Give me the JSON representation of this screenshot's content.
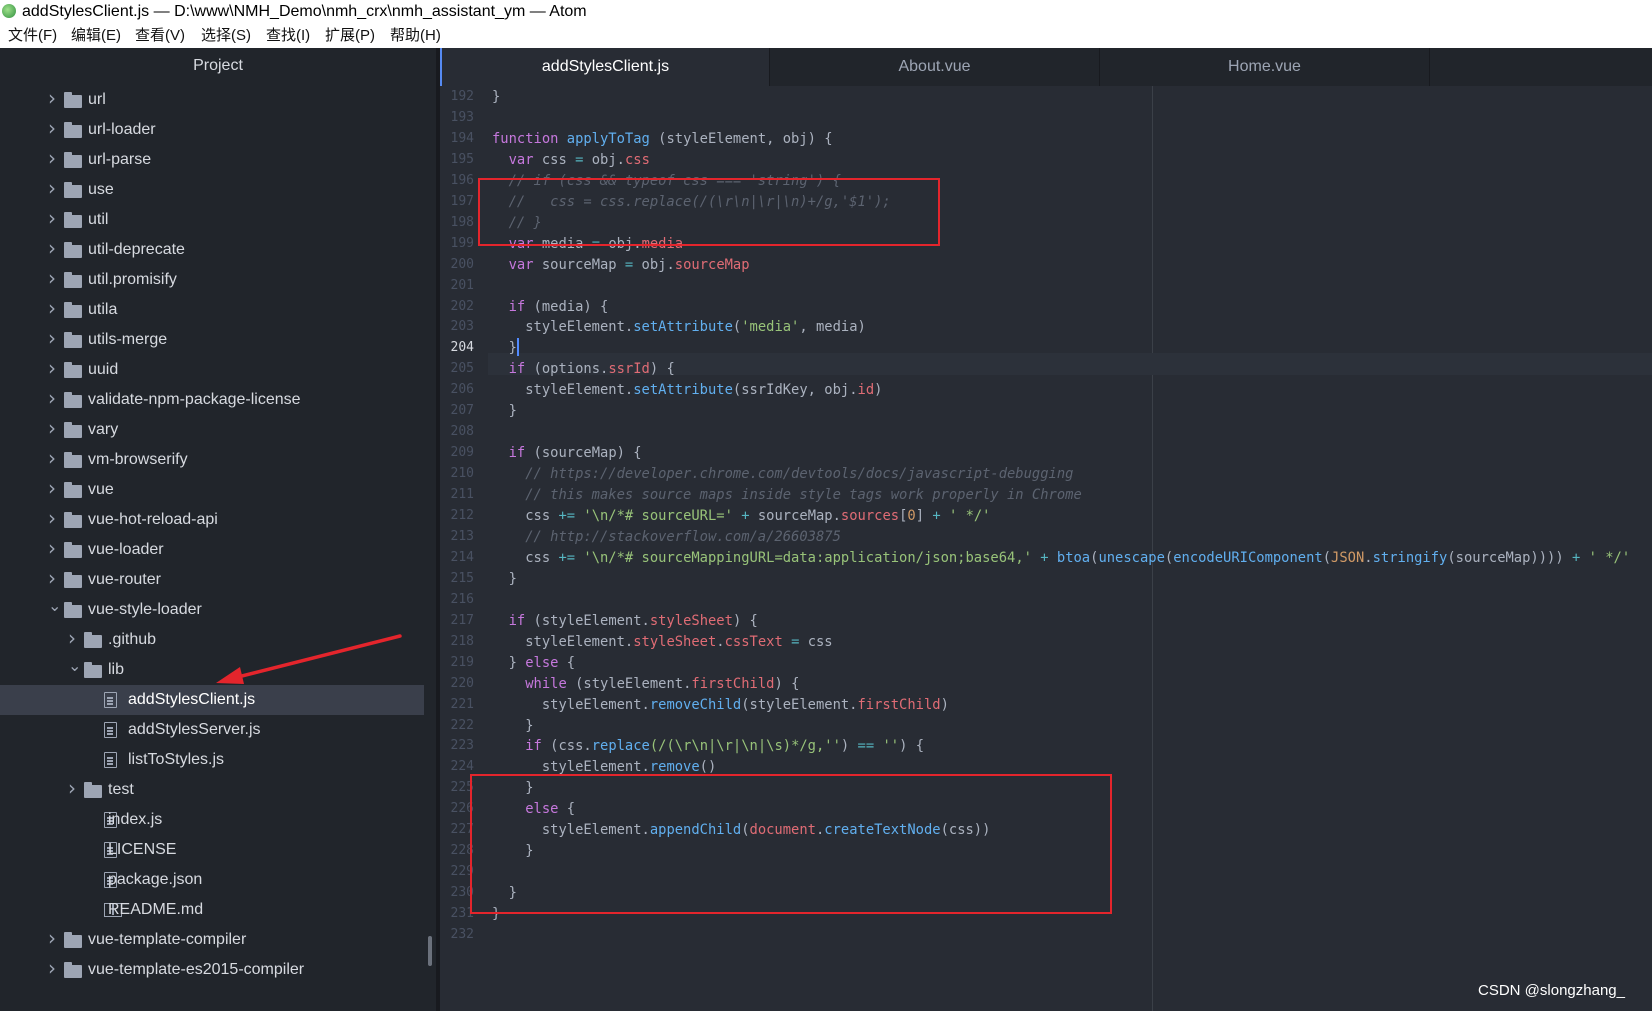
{
  "window": {
    "title": "addStylesClient.js — D:\\www\\NMH_Demo\\nmh_crx\\nmh_assistant_ym — Atom"
  },
  "menu": [
    "文件(F)",
    "编辑(E)",
    "查看(V)",
    "选择(S)",
    "查找(I)",
    "扩展(P)",
    "帮助(H)"
  ],
  "tree": {
    "header": "Project",
    "items": [
      {
        "label": "url",
        "kind": "folder",
        "depth": 0,
        "expanded": false
      },
      {
        "label": "url-loader",
        "kind": "folder",
        "depth": 0,
        "expanded": false
      },
      {
        "label": "url-parse",
        "kind": "folder",
        "depth": 0,
        "expanded": false
      },
      {
        "label": "use",
        "kind": "folder",
        "depth": 0,
        "expanded": false
      },
      {
        "label": "util",
        "kind": "folder",
        "depth": 0,
        "expanded": false
      },
      {
        "label": "util-deprecate",
        "kind": "folder",
        "depth": 0,
        "expanded": false
      },
      {
        "label": "util.promisify",
        "kind": "folder",
        "depth": 0,
        "expanded": false
      },
      {
        "label": "utila",
        "kind": "folder",
        "depth": 0,
        "expanded": false
      },
      {
        "label": "utils-merge",
        "kind": "folder",
        "depth": 0,
        "expanded": false
      },
      {
        "label": "uuid",
        "kind": "folder",
        "depth": 0,
        "expanded": false
      },
      {
        "label": "validate-npm-package-license",
        "kind": "folder",
        "depth": 0,
        "expanded": false
      },
      {
        "label": "vary",
        "kind": "folder",
        "depth": 0,
        "expanded": false
      },
      {
        "label": "vm-browserify",
        "kind": "folder",
        "depth": 0,
        "expanded": false
      },
      {
        "label": "vue",
        "kind": "folder",
        "depth": 0,
        "expanded": false
      },
      {
        "label": "vue-hot-reload-api",
        "kind": "folder",
        "depth": 0,
        "expanded": false
      },
      {
        "label": "vue-loader",
        "kind": "folder",
        "depth": 0,
        "expanded": false
      },
      {
        "label": "vue-router",
        "kind": "folder",
        "depth": 0,
        "expanded": false
      },
      {
        "label": "vue-style-loader",
        "kind": "folder",
        "depth": 0,
        "expanded": true
      },
      {
        "label": ".github",
        "kind": "folder",
        "depth": 1,
        "expanded": false
      },
      {
        "label": "lib",
        "kind": "folder",
        "depth": 1,
        "expanded": true
      },
      {
        "label": "addStylesClient.js",
        "kind": "file",
        "depth": 2,
        "selected": true
      },
      {
        "label": "addStylesServer.js",
        "kind": "file",
        "depth": 2
      },
      {
        "label": "listToStyles.js",
        "kind": "file",
        "depth": 2
      },
      {
        "label": "test",
        "kind": "folder",
        "depth": 1,
        "expanded": false
      },
      {
        "label": "index.js",
        "kind": "file",
        "depth": 1
      },
      {
        "label": "LICENSE",
        "kind": "file",
        "depth": 1
      },
      {
        "label": "package.json",
        "kind": "file",
        "depth": 1
      },
      {
        "label": "README.md",
        "kind": "book",
        "depth": 1
      },
      {
        "label": "vue-template-compiler",
        "kind": "folder",
        "depth": 0,
        "expanded": false
      },
      {
        "label": "vue-template-es2015-compiler",
        "kind": "folder",
        "depth": 0,
        "expanded": false
      }
    ]
  },
  "tabs": [
    {
      "label": "addStylesClient.js",
      "active": true
    },
    {
      "label": "About.vue",
      "active": false
    },
    {
      "label": "Home.vue",
      "active": false
    }
  ],
  "editor": {
    "cursor_line": 204,
    "lines": [
      {
        "n": 192,
        "t": [
          [
            "}",
            ""
          ]
        ]
      },
      {
        "n": 193,
        "t": []
      },
      {
        "n": 194,
        "t": [
          [
            "function",
            "kw"
          ],
          [
            " ",
            ""
          ],
          [
            "applyToTag",
            "fn"
          ],
          [
            " (styleElement, obj) {",
            ""
          ]
        ]
      },
      {
        "n": 195,
        "t": [
          [
            "  ",
            ""
          ],
          [
            "var",
            "kw"
          ],
          [
            " css ",
            ""
          ],
          [
            "=",
            "op"
          ],
          [
            " obj.",
            ""
          ],
          [
            "css",
            "pr"
          ]
        ]
      },
      {
        "n": 196,
        "t": [
          [
            "  // if (css && typeof css === 'string') {",
            "cm"
          ]
        ]
      },
      {
        "n": 197,
        "t": [
          [
            "  //   css = css.replace(/(\\r\\n|\\r|\\n)+/g,'$1');",
            "cm"
          ]
        ]
      },
      {
        "n": 198,
        "t": [
          [
            "  // }",
            "cm"
          ]
        ]
      },
      {
        "n": 199,
        "t": [
          [
            "  ",
            ""
          ],
          [
            "var",
            "kw"
          ],
          [
            " media ",
            ""
          ],
          [
            "=",
            "op"
          ],
          [
            " obj.",
            ""
          ],
          [
            "media",
            "pr"
          ]
        ]
      },
      {
        "n": 200,
        "t": [
          [
            "  ",
            ""
          ],
          [
            "var",
            "kw"
          ],
          [
            " sourceMap ",
            ""
          ],
          [
            "=",
            "op"
          ],
          [
            " obj.",
            ""
          ],
          [
            "sourceMap",
            "pr"
          ]
        ]
      },
      {
        "n": 201,
        "t": []
      },
      {
        "n": 202,
        "t": [
          [
            "  ",
            ""
          ],
          [
            "if",
            "kw"
          ],
          [
            " (media) {",
            ""
          ]
        ]
      },
      {
        "n": 203,
        "t": [
          [
            "    styleElement.",
            ""
          ],
          [
            "setAttribute",
            "fn"
          ],
          [
            "(",
            ""
          ],
          [
            "'media'",
            "st"
          ],
          [
            ", media)",
            ""
          ]
        ]
      },
      {
        "n": 204,
        "t": [
          [
            "  }",
            ""
          ],
          [
            "|",
            "caret"
          ]
        ]
      },
      {
        "n": 205,
        "t": [
          [
            "  ",
            ""
          ],
          [
            "if",
            "kw"
          ],
          [
            " (options.",
            ""
          ],
          [
            "ssrId",
            "pr"
          ],
          [
            ") {",
            ""
          ]
        ]
      },
      {
        "n": 206,
        "t": [
          [
            "    styleElement.",
            ""
          ],
          [
            "setAttribute",
            "fn"
          ],
          [
            "(ssrIdKey, obj.",
            ""
          ],
          [
            "id",
            "pr"
          ],
          [
            ")",
            ""
          ]
        ]
      },
      {
        "n": 207,
        "t": [
          [
            "  }",
            ""
          ]
        ]
      },
      {
        "n": 208,
        "t": []
      },
      {
        "n": 209,
        "t": [
          [
            "  ",
            ""
          ],
          [
            "if",
            "kw"
          ],
          [
            " (sourceMap) {",
            ""
          ]
        ]
      },
      {
        "n": 210,
        "t": [
          [
            "    // https://developer.chrome.com/devtools/docs/javascript-debugging",
            "cm"
          ]
        ]
      },
      {
        "n": 211,
        "t": [
          [
            "    // this makes source maps inside style tags work properly in Chrome",
            "cm"
          ]
        ]
      },
      {
        "n": 212,
        "t": [
          [
            "    css ",
            ""
          ],
          [
            "+=",
            "op"
          ],
          [
            " ",
            ""
          ],
          [
            "'\\n/*# sourceURL='",
            "st"
          ],
          [
            " ",
            ""
          ],
          [
            "+",
            "op"
          ],
          [
            " sourceMap.",
            ""
          ],
          [
            "sources",
            "pr"
          ],
          [
            "[",
            ""
          ],
          [
            "0",
            "nm"
          ],
          [
            "] ",
            ""
          ],
          [
            "+",
            "op"
          ],
          [
            " ",
            ""
          ],
          [
            "' */'",
            "st"
          ]
        ]
      },
      {
        "n": 213,
        "t": [
          [
            "    // http://stackoverflow.com/a/26603875",
            "cm"
          ]
        ]
      },
      {
        "n": 214,
        "t": [
          [
            "    css ",
            ""
          ],
          [
            "+=",
            "op"
          ],
          [
            " ",
            ""
          ],
          [
            "'\\n/*# sourceMappingURL=data:application/json;base64,'",
            "st"
          ],
          [
            " ",
            ""
          ],
          [
            "+",
            "op"
          ],
          [
            " ",
            ""
          ],
          [
            "btoa",
            "fn"
          ],
          [
            "(",
            ""
          ],
          [
            "unescape",
            "fn"
          ],
          [
            "(",
            ""
          ],
          [
            "encodeURIComponent",
            "fn"
          ],
          [
            "(",
            ""
          ],
          [
            "JSON",
            "nm"
          ],
          [
            ".",
            ""
          ],
          [
            "stringify",
            "fn"
          ],
          [
            "(sourceMap)))) ",
            ""
          ],
          [
            "+",
            "op"
          ],
          [
            " ",
            ""
          ],
          [
            "' */'",
            "st"
          ]
        ]
      },
      {
        "n": 215,
        "t": [
          [
            "  }",
            ""
          ]
        ]
      },
      {
        "n": 216,
        "t": []
      },
      {
        "n": 217,
        "t": [
          [
            "  ",
            ""
          ],
          [
            "if",
            "kw"
          ],
          [
            " (styleElement.",
            ""
          ],
          [
            "styleSheet",
            "pr"
          ],
          [
            ") {",
            ""
          ]
        ]
      },
      {
        "n": 218,
        "t": [
          [
            "    styleElement.",
            ""
          ],
          [
            "styleSheet",
            "pr"
          ],
          [
            ".",
            ""
          ],
          [
            "cssText",
            "pr"
          ],
          [
            " ",
            ""
          ],
          [
            "=",
            "op"
          ],
          [
            " css",
            ""
          ]
        ]
      },
      {
        "n": 219,
        "t": [
          [
            "  } ",
            ""
          ],
          [
            "else",
            "kw"
          ],
          [
            " {",
            ""
          ]
        ]
      },
      {
        "n": 220,
        "t": [
          [
            "    ",
            ""
          ],
          [
            "while",
            "kw"
          ],
          [
            " (styleElement.",
            ""
          ],
          [
            "firstChild",
            "pr"
          ],
          [
            ") {",
            ""
          ]
        ]
      },
      {
        "n": 221,
        "t": [
          [
            "      styleElement.",
            ""
          ],
          [
            "removeChild",
            "fn"
          ],
          [
            "(styleElement.",
            ""
          ],
          [
            "firstChild",
            "pr"
          ],
          [
            ")",
            ""
          ]
        ]
      },
      {
        "n": 222,
        "t": [
          [
            "    }",
            ""
          ]
        ]
      },
      {
        "n": 223,
        "t": [
          [
            "    ",
            ""
          ],
          [
            "if",
            "kw"
          ],
          [
            " (css.",
            ""
          ],
          [
            "replace",
            "fn"
          ],
          [
            "(/(\\r\\n|\\r|\\n|\\s)*/g,",
            "st"
          ],
          [
            "''",
            "st"
          ],
          [
            ") ",
            ""
          ],
          [
            "==",
            "op"
          ],
          [
            " ",
            ""
          ],
          [
            "''",
            "st"
          ],
          [
            ") {",
            ""
          ]
        ]
      },
      {
        "n": 224,
        "t": [
          [
            "      styleElement.",
            ""
          ],
          [
            "remove",
            "fn"
          ],
          [
            "()",
            ""
          ]
        ]
      },
      {
        "n": 225,
        "t": [
          [
            "    }",
            ""
          ]
        ]
      },
      {
        "n": 226,
        "t": [
          [
            "    ",
            ""
          ],
          [
            "else",
            "kw"
          ],
          [
            " {",
            ""
          ]
        ]
      },
      {
        "n": 227,
        "t": [
          [
            "      styleElement.",
            ""
          ],
          [
            "appendChild",
            "fn"
          ],
          [
            "(",
            ""
          ],
          [
            "document",
            "pr"
          ],
          [
            ".",
            ""
          ],
          [
            "createTextNode",
            "fn"
          ],
          [
            "(css))",
            ""
          ]
        ]
      },
      {
        "n": 228,
        "t": [
          [
            "    }",
            ""
          ]
        ]
      },
      {
        "n": 229,
        "t": []
      },
      {
        "n": 230,
        "t": [
          [
            "  }",
            ""
          ]
        ]
      },
      {
        "n": 231,
        "t": [
          [
            "}",
            ""
          ]
        ]
      },
      {
        "n": 232,
        "t": []
      }
    ]
  },
  "annotations": {
    "highlight_color": "#e4252c",
    "boxed_lines": [
      [
        196,
        198
      ],
      [
        223,
        229
      ]
    ],
    "arrow_target": "addStylesClient.js"
  },
  "watermark": "CSDN @slongzhang_"
}
